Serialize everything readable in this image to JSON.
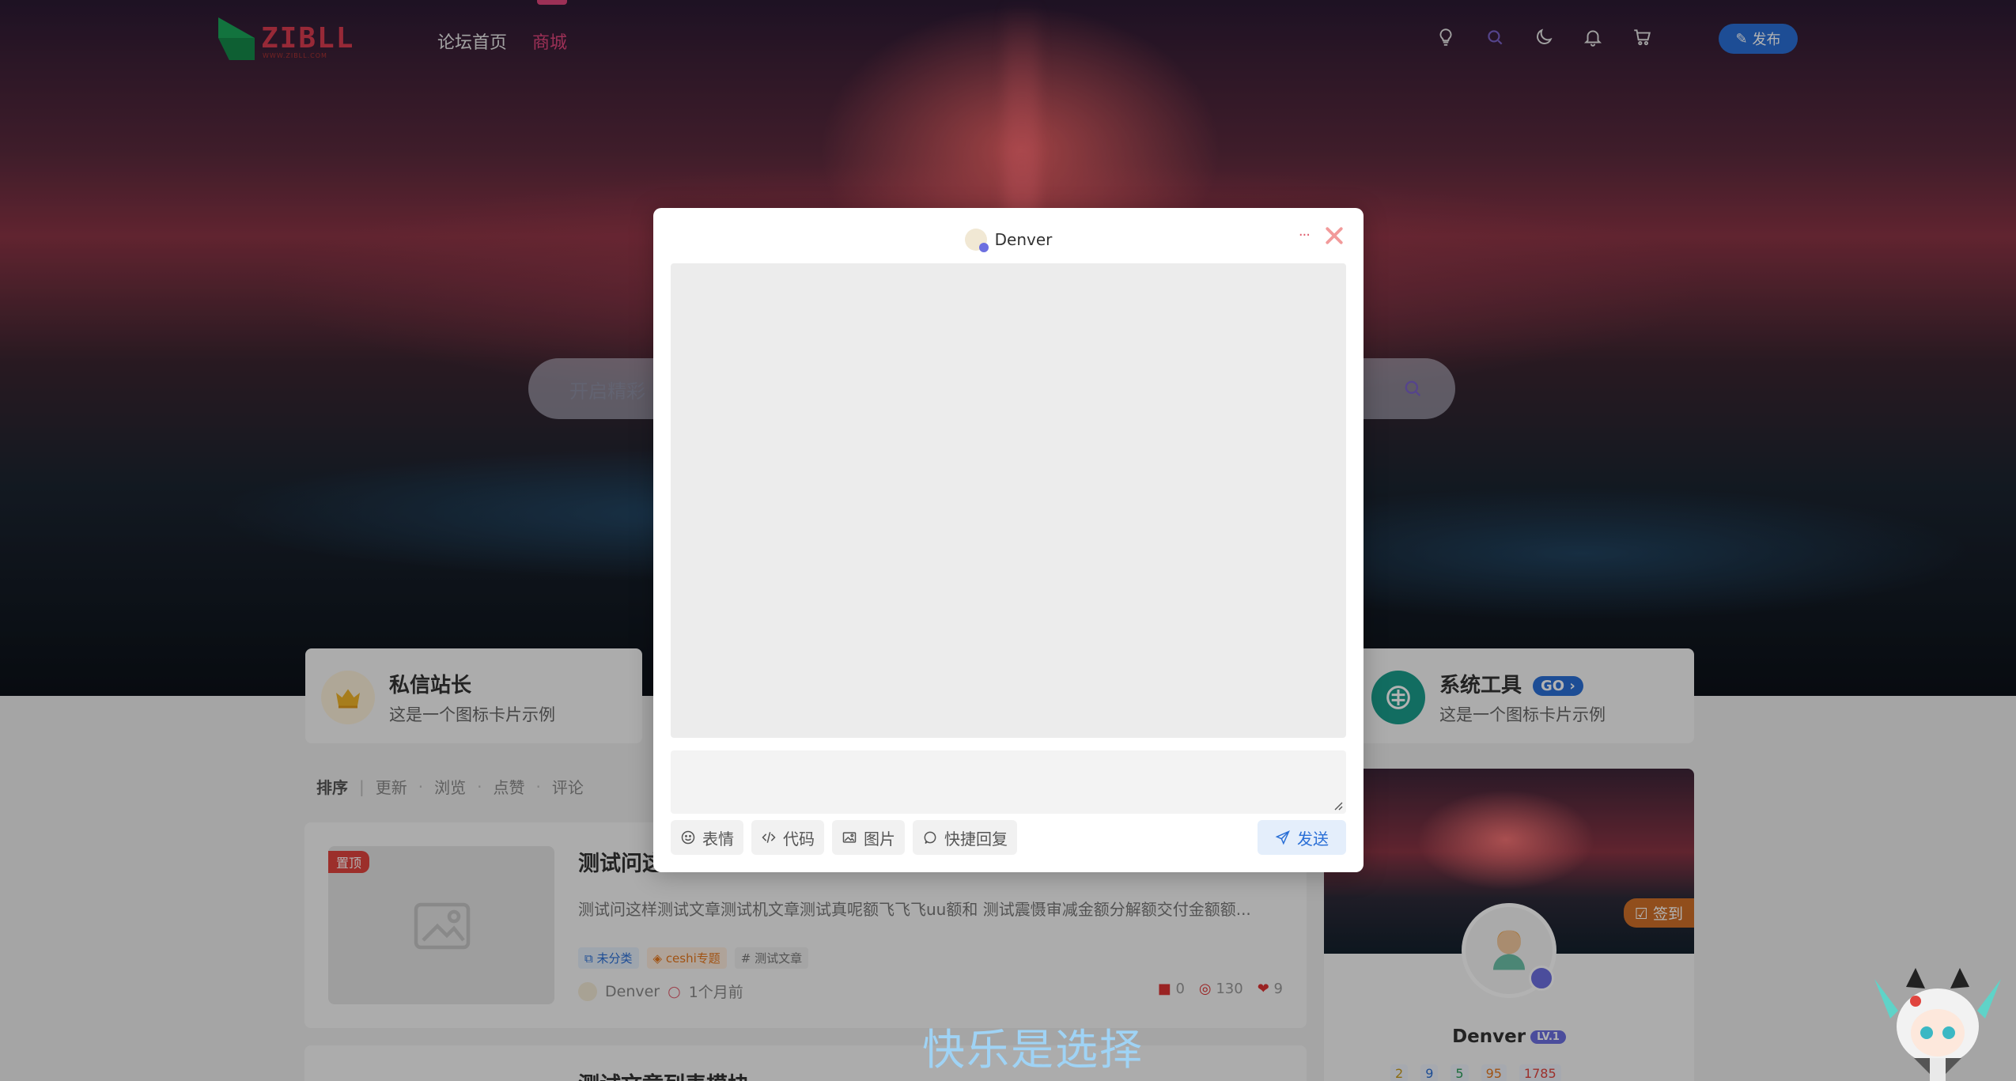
{
  "header": {
    "logo_text": "ZIBLL",
    "logo_sub": "WWW.ZIBLL.COM",
    "nav": [
      {
        "label": "论坛首页",
        "active": false
      },
      {
        "label": "商城",
        "active": true
      }
    ],
    "publish_label": "发布"
  },
  "search": {
    "placeholder": "开启精彩"
  },
  "icon_cards": [
    {
      "title": "私信站长",
      "desc": "这是一个图标卡片示例"
    },
    {
      "title": "系统工具",
      "badge": "GO",
      "desc": "这是一个图标卡片示例"
    }
  ],
  "sort": {
    "label": "排序",
    "options": [
      "更新",
      "浏览",
      "点赞",
      "评论"
    ]
  },
  "posts": [
    {
      "pin": "置顶",
      "title": "测试问这",
      "excerpt": "测试问这样测试文章测试机文章测试真呢额飞飞飞uu额和 测试震慑审减金额分解额交付金额额...",
      "tags": {
        "category": "未分类",
        "topic": "ceshi专题",
        "hash": "# 测试文章"
      },
      "author": "Denver",
      "time": "1个月前",
      "comments": "0",
      "views": "130",
      "likes": "9"
    },
    {
      "title": "测试文章列表模块"
    }
  ],
  "sidebar": {
    "signin_label": "签到",
    "username": "Denver",
    "level": "LV.1",
    "stats": [
      "2",
      "9",
      "5",
      "95",
      "1785"
    ]
  },
  "modal": {
    "title": "Denver",
    "more": "···",
    "toolbar": [
      "表情",
      "代码",
      "图片",
      "快捷回复"
    ],
    "send_label": "发送"
  },
  "overlay_text": "快乐是选择",
  "colors": {
    "accent": "#2a6fd6",
    "nav_active": "#e0457b",
    "pin": "#e0443e"
  }
}
